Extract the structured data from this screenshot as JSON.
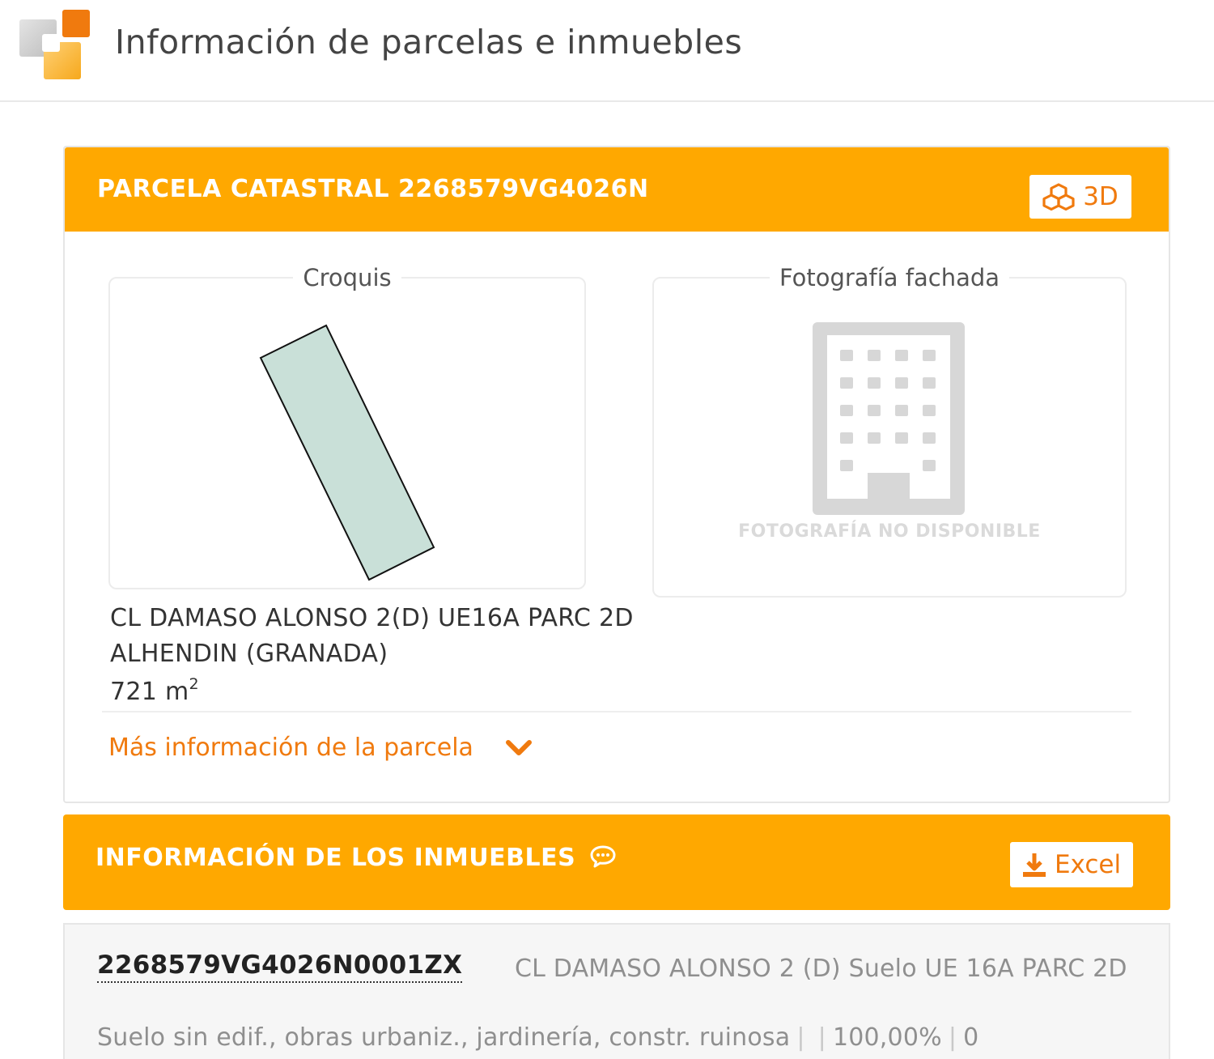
{
  "header": {
    "title": "Información de parcelas e inmuebles"
  },
  "parcela": {
    "title": "PARCELA CATASTRAL 2268579VG4026N",
    "button_3d": "3D",
    "croquis_label": "Croquis",
    "foto_label": "Fotografía fachada",
    "foto_unavailable": "FOTOGRAFÍA NO DISPONIBLE",
    "address_line1": "CL DAMASO ALONSO 2(D) UE16A PARC 2D",
    "address_line2": "ALHENDIN (GRANADA)",
    "surface_value": "721 m",
    "surface_sup": "2",
    "more_info": "Más información de la parcela"
  },
  "inmuebles": {
    "title": "INFORMACIÓN DE LOS INMUEBLES",
    "excel_label": "Excel",
    "items": [
      {
        "ref": "2268579VG4026N0001ZX",
        "address": "CL DAMASO ALONSO 2 (D) Suelo UE 16A PARC 2D",
        "use": "Suelo sin edif., obras urbaniz., jardinería, constr. ruinosa",
        "participation": "100,00%",
        "year": "0"
      }
    ]
  },
  "colors": {
    "accent_orange": "#ffa800",
    "link_orange": "#f07a0e",
    "parcel_fill": "#c9e0d8"
  },
  "icons": {
    "logo": "catastro-logo-icon",
    "btn_3d": "cubes-icon",
    "more_info": "chevron-down-icon",
    "inmuebles_title": "comment-icon",
    "excel": "download-icon",
    "foto": "building-icon"
  }
}
